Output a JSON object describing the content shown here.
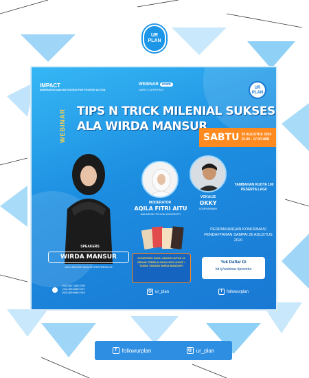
{
  "logo": {
    "line1": "UR",
    "line2": "PLAN"
  },
  "poster": {
    "impact_title": "IMPACT",
    "impact_subtitle": "INSPIRATION AND MOTIVATION FOR POSITIVE ACTION",
    "webinar_label": "WEBINAR",
    "zoom_label": "zoom",
    "webinar_sub": "DAPAT E-SERTIFIKAT",
    "ur_circle": {
      "line1": "UR",
      "line2": "PLAN"
    },
    "side_label": "WEBINAR",
    "title_line1": "TIPS N TRICK MILENIAL SUKSES",
    "title_line2": "ALA WIRDA MANSUR",
    "date": {
      "day": "SABTU",
      "date": "29 AGUSTUS 2020",
      "time": "15.00 - 17.00 WIB"
    },
    "moderator": {
      "role": "MODERATOR",
      "name": "AQILA FITRI AITU",
      "desc": "MAHASISWI TELKOM UNIVERSITY"
    },
    "vokalis": {
      "role": "VOKALIS",
      "name": "OKKY",
      "desc": "KOMPARAWAN"
    },
    "tambahan": "TAMBAHAN KUOTA 100 PESERTA LAGI!",
    "perpanjangan": "PERPANJANGAN KONFIRMASI PENDAFTARAN SAMPAI 26 AGUSTUS 2020",
    "daftar": {
      "title": "Yuk Daftar Di",
      "link": "bit.ly/webinar-tipswirda"
    },
    "speaker": {
      "role": "SPEAKERS",
      "name": "WIRDA MANSUR",
      "desc": "INFLUENCER DAN ENTREPRENEUR"
    },
    "doorprize": "DOORPRIZE BUKU GRATIS UNTUK 10 ORANG TERPILIH BUKU EXCLUSIVE + TANDA TANGAN WIRDA MANSUR!!",
    "contacts": [
      "(+62) 857 3166 3799",
      "(+62) 859 6866 5747",
      "(+62) 859 6866 5748"
    ],
    "instagram": "ur_plan",
    "facebook": "followurplan"
  },
  "footer": {
    "facebook": "followurplan",
    "instagram": "ur_plan"
  },
  "colors": {
    "primary": "#1f8fe0",
    "accent": "#ff8a1f",
    "highlight": "#ffd24a"
  }
}
